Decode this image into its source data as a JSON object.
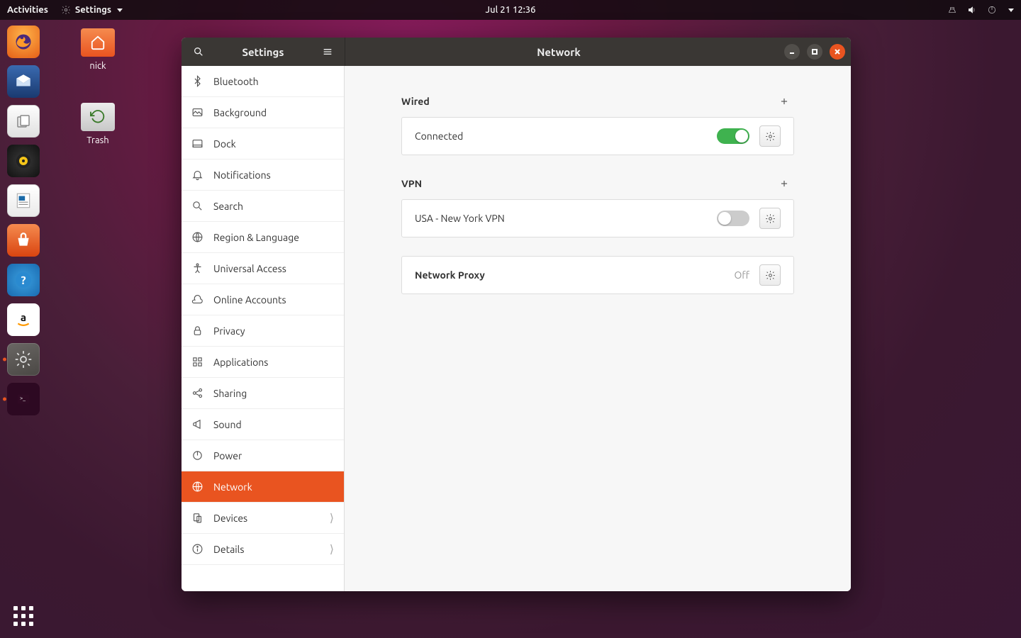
{
  "top_panel": {
    "activities": "Activities",
    "app_menu": "Settings",
    "clock": "Jul 21  12:36"
  },
  "desktop": {
    "home_label": "nick",
    "trash_label": "Trash"
  },
  "window": {
    "sidebar_title": "Settings",
    "content_title": "Network"
  },
  "sidebar": {
    "items": [
      {
        "id": "bluetooth",
        "label": "Bluetooth"
      },
      {
        "id": "background",
        "label": "Background"
      },
      {
        "id": "dock",
        "label": "Dock"
      },
      {
        "id": "notifications",
        "label": "Notifications"
      },
      {
        "id": "search",
        "label": "Search"
      },
      {
        "id": "region-language",
        "label": "Region & Language"
      },
      {
        "id": "universal-access",
        "label": "Universal Access"
      },
      {
        "id": "online-accounts",
        "label": "Online Accounts"
      },
      {
        "id": "privacy",
        "label": "Privacy"
      },
      {
        "id": "applications",
        "label": "Applications"
      },
      {
        "id": "sharing",
        "label": "Sharing"
      },
      {
        "id": "sound",
        "label": "Sound"
      },
      {
        "id": "power",
        "label": "Power"
      },
      {
        "id": "network",
        "label": "Network",
        "selected": true
      },
      {
        "id": "devices",
        "label": "Devices",
        "has_children": true
      },
      {
        "id": "details",
        "label": "Details",
        "has_children": true
      }
    ]
  },
  "network": {
    "wired": {
      "heading": "Wired",
      "status": "Connected",
      "enabled": true
    },
    "vpn": {
      "heading": "VPN",
      "items": [
        {
          "label": "USA - New York VPN",
          "enabled": false
        }
      ]
    },
    "proxy": {
      "heading": "Network Proxy",
      "state": "Off"
    }
  }
}
